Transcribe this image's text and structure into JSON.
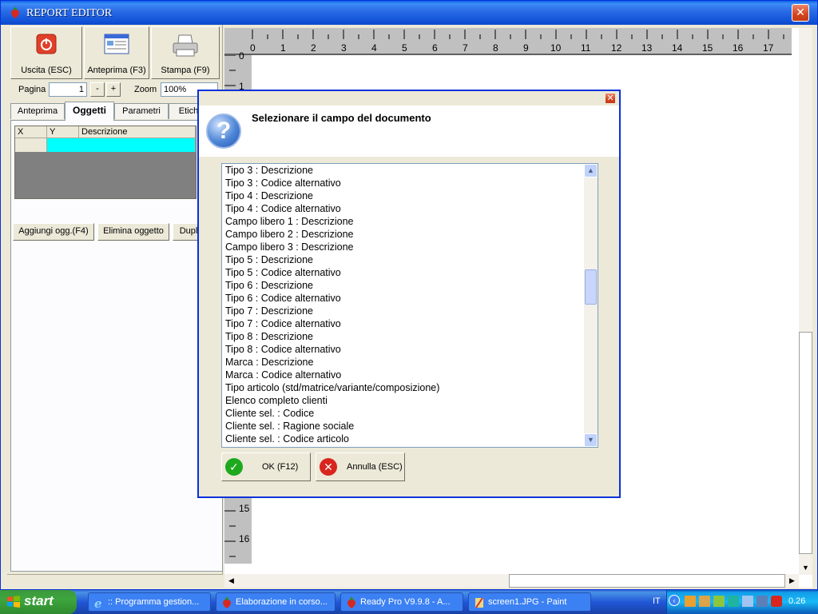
{
  "window": {
    "title": "REPORT EDITOR"
  },
  "toolbar": {
    "exit_label": "Uscita (ESC)",
    "preview_label": "Anteprima (F3)",
    "print_label": "Stampa (F9)",
    "page_label": "Pagina",
    "page_value": "1",
    "minus_label": "-",
    "plus_label": "+",
    "zoom_label": "Zoom",
    "zoom_value": "100%"
  },
  "tabs": [
    {
      "label": "Anteprima"
    },
    {
      "label": "Oggetti"
    },
    {
      "label": "Parametri"
    },
    {
      "label": "Etich"
    }
  ],
  "grid": {
    "columns": [
      "X",
      "Y",
      "Descrizione"
    ]
  },
  "panel_buttons": {
    "add_label": "Aggiungi ogg.(F4)",
    "delete_label": "Elimina oggetto",
    "dup_label": "Dupl"
  },
  "ruler": {
    "top": [
      "0",
      "1",
      "2",
      "3",
      "4",
      "5",
      "6",
      "7",
      "8",
      "9",
      "10",
      "11",
      "12",
      "13",
      "14",
      "15",
      "16",
      "17"
    ],
    "left_top": [
      "0",
      "1"
    ],
    "left_bottom": [
      "15",
      "16"
    ]
  },
  "dialog": {
    "title": "Selezionare il campo del documento",
    "items": [
      "Tipo 3 : Descrizione",
      "Tipo 3 : Codice alternativo",
      "Tipo 4 : Descrizione",
      "Tipo 4 : Codice alternativo",
      "Campo libero 1 : Descrizione",
      "Campo libero 2 : Descrizione",
      "Campo libero 3 : Descrizione",
      "Tipo 5 : Descrizione",
      "Tipo 5 : Codice alternativo",
      "Tipo 6 : Descrizione",
      "Tipo 6 : Codice alternativo",
      "Tipo 7 : Descrizione",
      "Tipo 7 : Codice alternativo",
      "Tipo 8 : Descrizione",
      "Tipo 8 : Codice alternativo",
      "Marca : Descrizione",
      "Marca : Codice alternativo",
      "Tipo articolo (std/matrice/variante/composizione)",
      "Elenco completo clienti",
      "Cliente sel. : Codice",
      "Cliente sel. : Ragione sociale",
      "Cliente sel. : Codice articolo"
    ],
    "ok_label": "OK (F12)",
    "cancel_label": "Annulla (ESC)"
  },
  "taskbar": {
    "start_label": "start",
    "tasks": [
      {
        "label": ":: Programma gestion..."
      },
      {
        "label": "Elaborazione in corso..."
      },
      {
        "label": "Ready Pro V9.9.8 - A..."
      },
      {
        "label": "screen1.JPG - Paint"
      }
    ],
    "lang": "IT",
    "clock": "0.26"
  },
  "colors": {
    "title_blue": "#0a5fe8",
    "selected_row": "#00ffff",
    "ok_green": "#1ea81e",
    "cancel_red": "#d8261e"
  }
}
